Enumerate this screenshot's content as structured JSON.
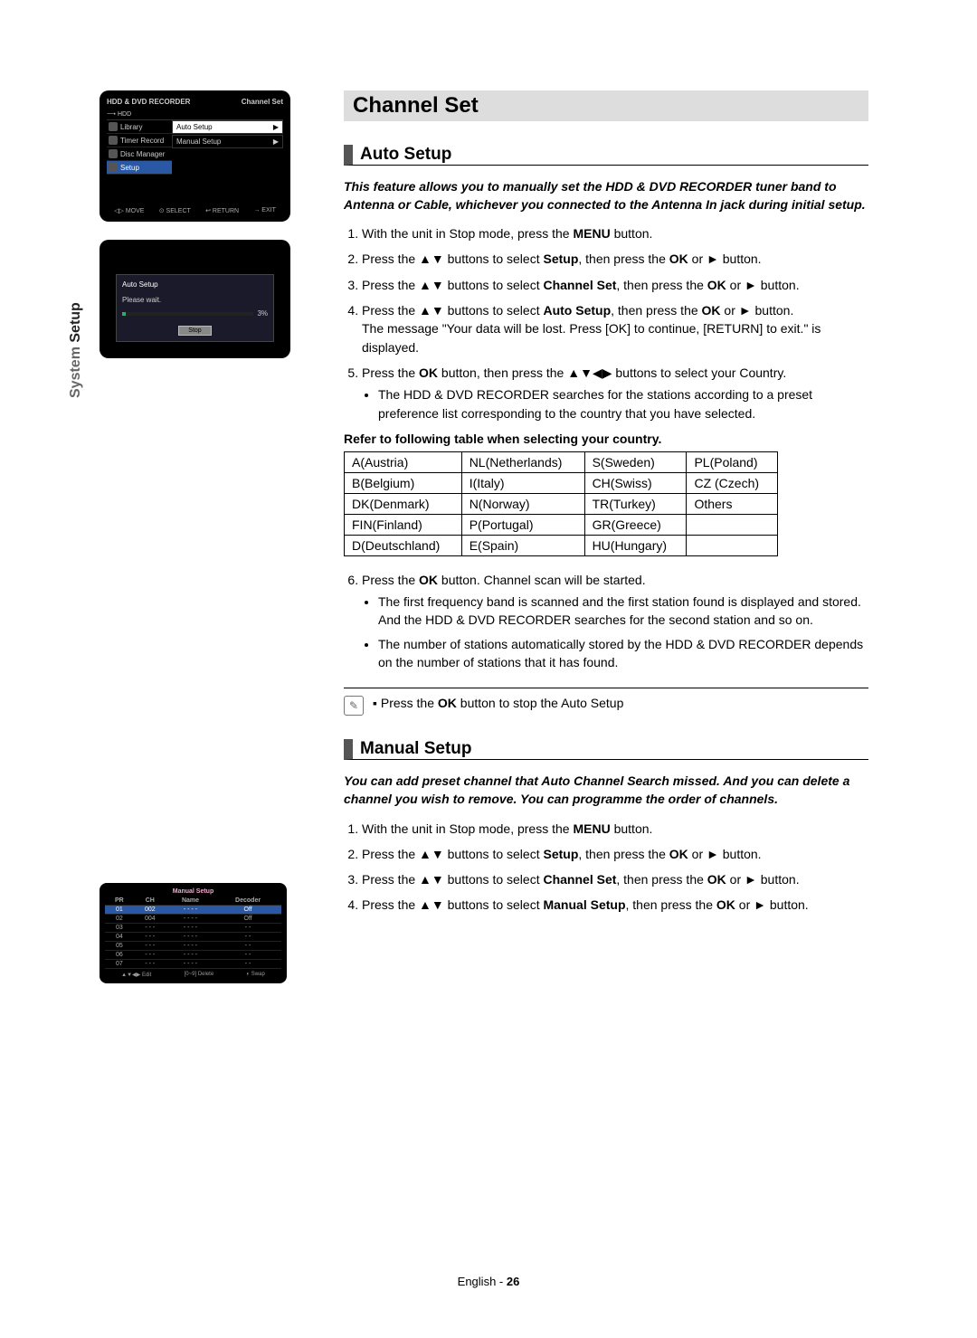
{
  "side_tab": {
    "light": "System ",
    "dark": "Setup"
  },
  "osd1": {
    "title_left": "HDD & DVD RECORDER",
    "title_right": "Channel Set",
    "hdd": "HDD",
    "menu": [
      "Library",
      "Timer Record",
      "Disc Manager",
      "Setup"
    ],
    "sub": [
      "Auto Setup",
      "Manual Setup"
    ],
    "foot": [
      "◁▷ MOVE",
      "⊙ SELECT",
      "↩ RETURN",
      "→ EXIT"
    ]
  },
  "osd2": {
    "box_title": "Auto Setup",
    "msg": "Please wait.",
    "pct": "3%",
    "btn": "Stop"
  },
  "osd3": {
    "title": "Manual Setup",
    "headers": [
      "PR",
      "CH",
      "Name",
      "Decoder"
    ],
    "rows": [
      [
        "01",
        "002",
        "- - - -",
        "Off"
      ],
      [
        "02",
        "004",
        "- - - -",
        "Off"
      ],
      [
        "03",
        "- - -",
        "- - - -",
        "- -"
      ],
      [
        "04",
        "- - -",
        "- - - -",
        "- -"
      ],
      [
        "05",
        "- - -",
        "- - - -",
        "- -"
      ],
      [
        "06",
        "- - -",
        "- - - -",
        "- -"
      ],
      [
        "07",
        "- - -",
        "- - - -",
        "- -"
      ]
    ],
    "foot": [
      "▲▼◀▶ Edit",
      "[0~9] Delete",
      "◐ Swap"
    ]
  },
  "band": "Channel Set",
  "auto": {
    "heading": "Auto Setup",
    "intro": "This feature allows you to manually set the HDD & DVD RECORDER tuner band to Antenna or Cable, whichever you connected to the Antenna In jack during initial setup.",
    "s1_a": "With the unit in Stop mode, press the ",
    "s1_b": "MENU",
    "s1_c": " button.",
    "s2_a": "Press the ▲▼ buttons to select ",
    "s2_b": "Setup",
    "s2_c": ", then press the ",
    "s2_d": "OK",
    "s2_e": " or ► button.",
    "s3_a": "Press the ▲▼ buttons to select ",
    "s3_b": "Channel Set",
    "s3_c": ", then press the ",
    "s3_d": "OK",
    "s3_e": " or ► button.",
    "s4_a": "Press the ▲▼ buttons to select ",
    "s4_b": "Auto Setup",
    "s4_c": ", then press the ",
    "s4_d": "OK",
    "s4_e": " or ► button.",
    "s4_msg": "The message \"Your data will be lost. Press [OK] to continue, [RETURN] to exit.\" is displayed.",
    "s5_a": "Press the ",
    "s5_b": "OK",
    "s5_c": " button, then press the ▲▼◀▶ buttons to select your Country.",
    "s5_sub": "The HDD & DVD RECORDER searches for the stations according to a preset preference list corresponding to the country that you have selected.",
    "table_note": "Refer to following table when selecting your country.",
    "country_table": [
      [
        "A(Austria)",
        "NL(Netherlands)",
        "S(Sweden)",
        "PL(Poland)"
      ],
      [
        "B(Belgium)",
        "I(Italy)",
        "CH(Swiss)",
        "CZ (Czech)"
      ],
      [
        "DK(Denmark)",
        "N(Norway)",
        "TR(Turkey)",
        "Others"
      ],
      [
        "FIN(Finland)",
        "P(Portugal)",
        "GR(Greece)",
        ""
      ],
      [
        "D(Deutschland)",
        "E(Spain)",
        "HU(Hungary)",
        ""
      ]
    ],
    "s6_a": "Press the ",
    "s6_b": "OK",
    "s6_c": " button. Channel scan will be started.",
    "s6_sub1": "The first frequency band is scanned and the first station found is displayed and stored. And the HDD & DVD RECORDER searches for the second station and so on.",
    "s6_sub2": "The number of stations automatically stored by the HDD & DVD RECORDER depends on the number of stations that it has found.",
    "note_a": "Press the ",
    "note_b": "OK",
    "note_c": " button to stop the Auto Setup"
  },
  "manual": {
    "heading": "Manual Setup",
    "intro": "You can add preset channel that Auto Channel Search missed. And you can delete a channel you wish to remove. You can programme the order of channels.",
    "s1_a": "With the unit in Stop mode, press the ",
    "s1_b": "MENU",
    "s1_c": " button.",
    "s2_a": "Press the ▲▼ buttons to select ",
    "s2_b": "Setup",
    "s2_c": ", then press the ",
    "s2_d": "OK",
    "s2_e": " or ► button.",
    "s3_a": "Press the ▲▼  buttons to select ",
    "s3_b": "Channel Set",
    "s3_c": ", then press the ",
    "s3_d": "OK",
    "s3_e": " or ► button.",
    "s4_a": "Press the ▲▼  buttons to select ",
    "s4_b": "Manual Setup",
    "s4_c": ", then press the ",
    "s4_d": "OK",
    "s4_e": " or ► button."
  },
  "footer": {
    "lang": "English - ",
    "page": "26"
  }
}
